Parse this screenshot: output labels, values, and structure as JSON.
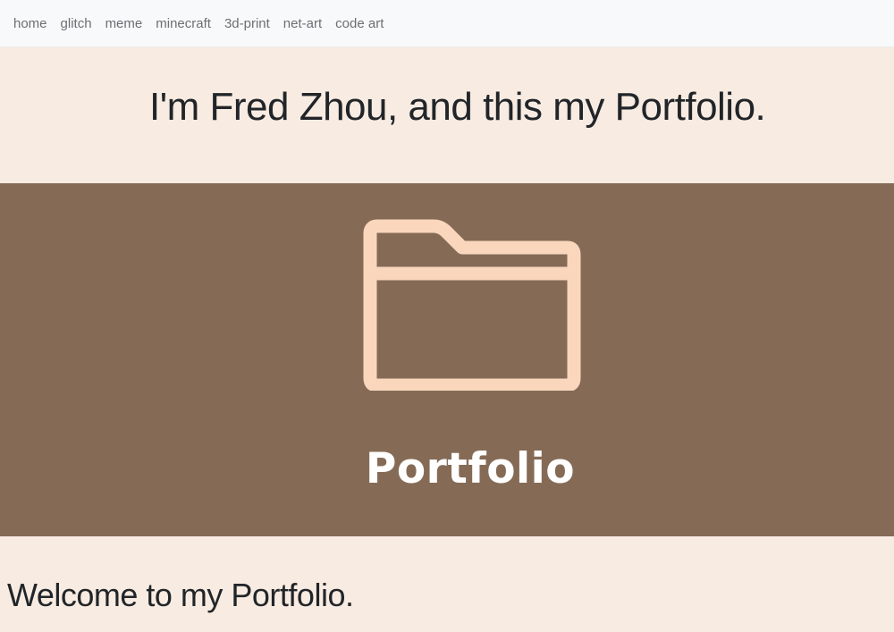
{
  "nav": {
    "items": [
      {
        "label": "home"
      },
      {
        "label": "glitch"
      },
      {
        "label": "meme"
      },
      {
        "label": "minecraft"
      },
      {
        "label": "3d-print"
      },
      {
        "label": "net-art"
      },
      {
        "label": "code art"
      }
    ]
  },
  "hero": {
    "title": "I'm Fred Zhou, and this my Portfolio."
  },
  "banner": {
    "icon": "folder-icon",
    "label": "Portfolio",
    "background_color": "#856b56",
    "icon_color": "#f9d6bc"
  },
  "content": {
    "heading": "Welcome to my Portfolio."
  },
  "colors": {
    "page_background": "#f8ebe1",
    "navbar_background": "#f8f9fa",
    "text_dark": "#212529",
    "nav_text": "#6c6f72"
  }
}
